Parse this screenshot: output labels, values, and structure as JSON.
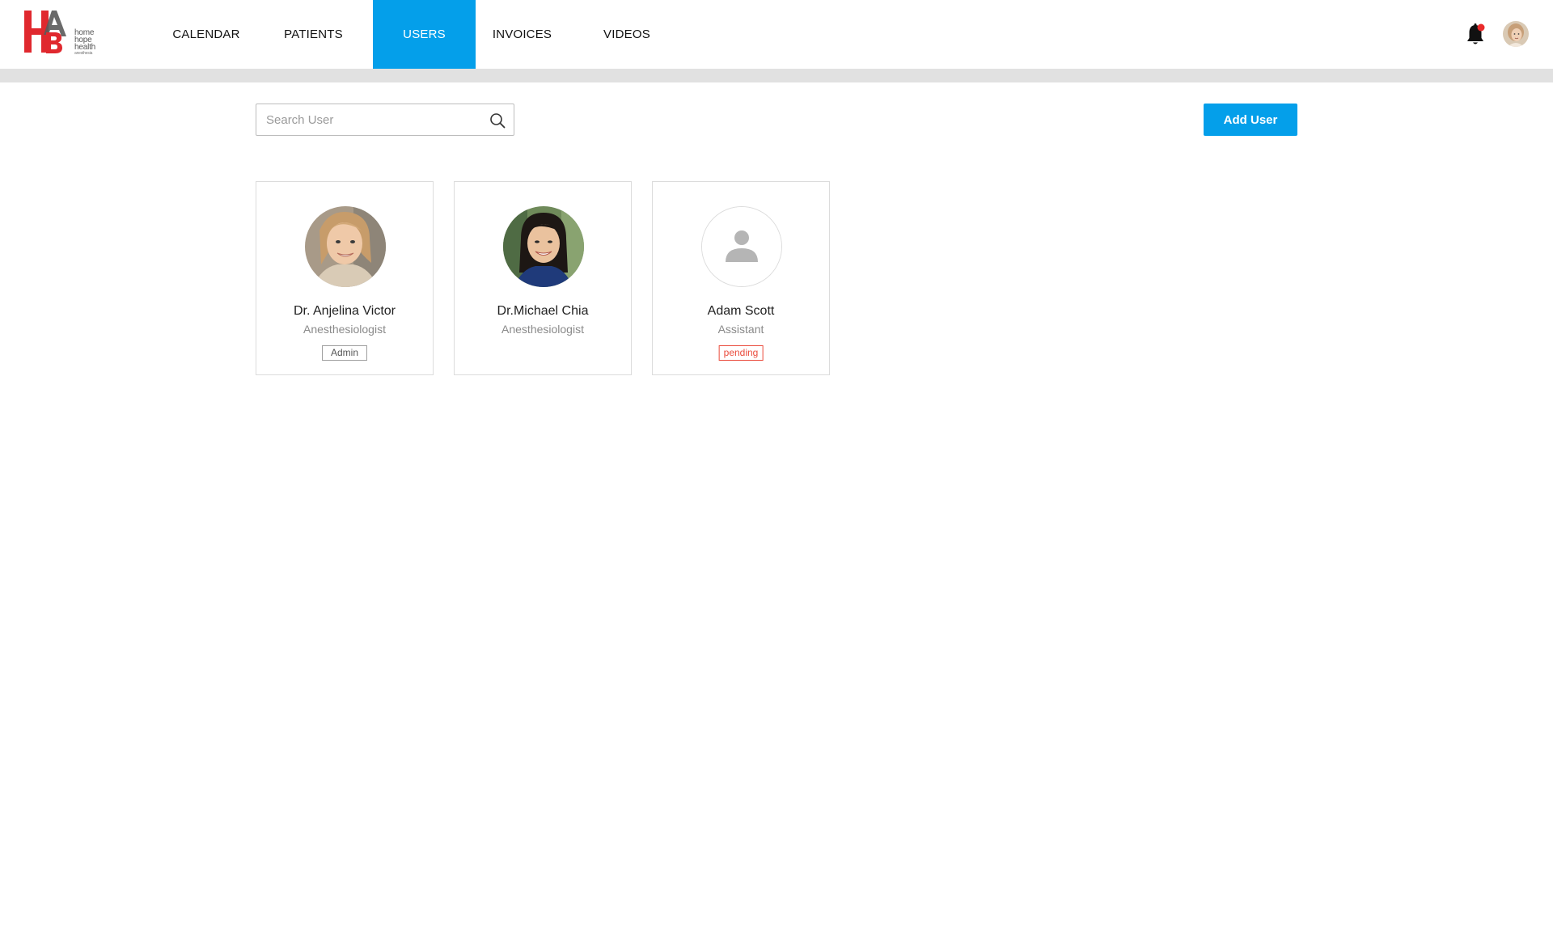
{
  "brand": {
    "logo_letters": "HAB",
    "logo_lines": [
      "home",
      "hope",
      "health",
      "anesthesia"
    ],
    "primary_color": "#049fea",
    "logo_red": "#e0282e",
    "logo_gray": "#555555"
  },
  "nav": {
    "items": [
      {
        "label": "CALENDAR",
        "active": false
      },
      {
        "label": "PATIENTS",
        "active": false
      },
      {
        "label": "USERS",
        "active": true
      },
      {
        "label": "INVOICES",
        "active": false
      },
      {
        "label": "VIDEOS",
        "active": false
      }
    ],
    "notification_icon": "bell-icon",
    "notification_dot_color": "#ea2b2b",
    "profile_icon": "avatar"
  },
  "toolbar": {
    "search_placeholder": "Search User",
    "search_value": "",
    "search_icon": "search-icon",
    "add_user_label": "Add User"
  },
  "users": [
    {
      "name": "Dr. Anjelina Victor",
      "role": "Anesthesiologist",
      "badge": "Admin",
      "badge_type": "admin",
      "avatar": "photo"
    },
    {
      "name": "Dr.Michael Chia",
      "role": "Anesthesiologist",
      "badge": "",
      "badge_type": "",
      "avatar": "photo"
    },
    {
      "name": "Adam Scott",
      "role": "Assistant",
      "badge": "pending",
      "badge_type": "pending",
      "avatar": "placeholder-person-icon"
    }
  ],
  "colors": {
    "pending": "#ea4b3c",
    "divider_strip": "#e1e1e1"
  }
}
